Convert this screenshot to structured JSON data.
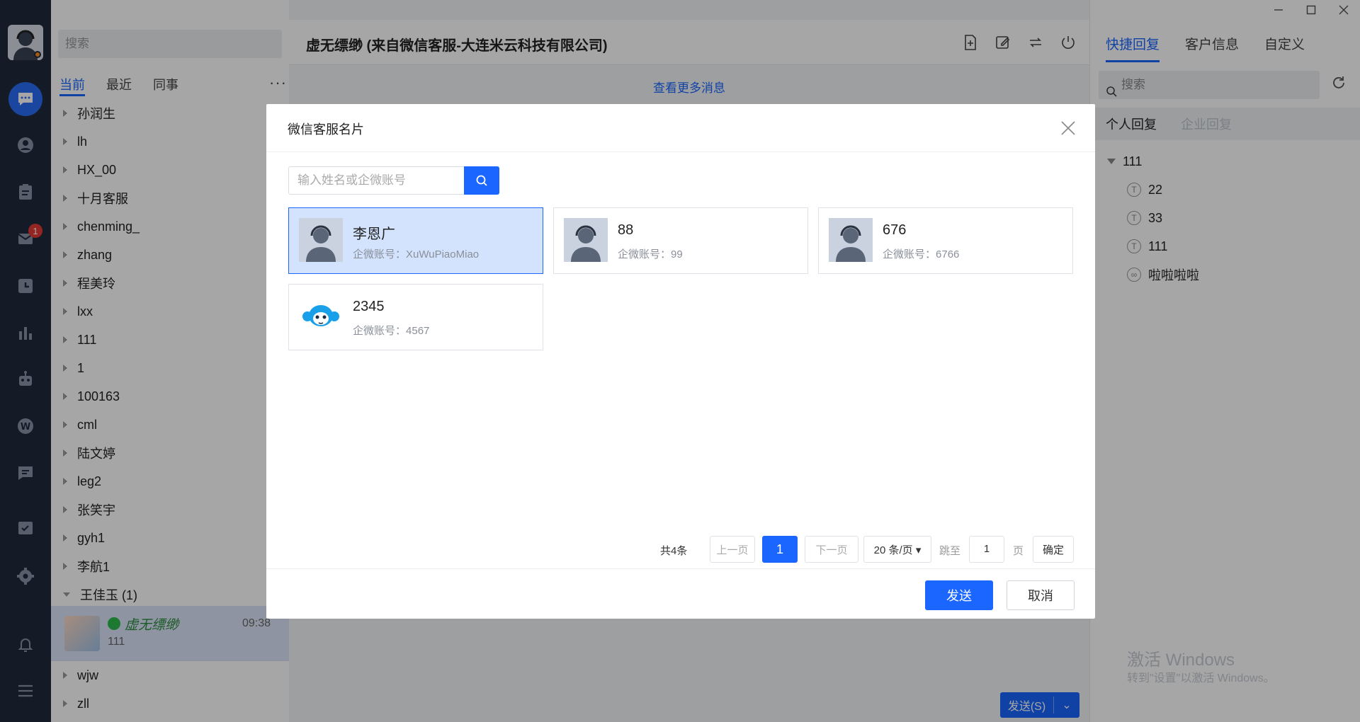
{
  "window": {
    "controls": [
      "minimize",
      "maximize",
      "close"
    ]
  },
  "rail": {
    "unread_badge": "1",
    "icons": [
      "chat-icon",
      "contacts-icon",
      "clipboard-icon",
      "mail-icon",
      "history-icon",
      "stats-icon",
      "robot-icon",
      "weibo-icon",
      "message-icon",
      "tasks-icon",
      "settings-icon",
      "bell-icon",
      "menu-icon"
    ]
  },
  "contacts": {
    "search_placeholder": "搜索",
    "tabs": [
      {
        "label": "当前",
        "active": true
      },
      {
        "label": "最近",
        "active": false
      },
      {
        "label": "同事",
        "active": false
      }
    ],
    "more_label": "···",
    "groups_before": [
      "孙润生",
      "lh",
      "HX_00",
      "十月客服",
      "chenming_",
      "zhang",
      "程美玲",
      "lxx",
      "111",
      "1",
      "100163",
      "cml",
      "陆文婷",
      "leg2",
      "张笑宇",
      "gyh1",
      "李航1",
      "王佳玉 (1)"
    ],
    "session": {
      "name": "虚无缥缈",
      "time": "09:38",
      "message": "111"
    },
    "groups_after": [
      "wjw",
      "zll"
    ]
  },
  "chat": {
    "title": "虚无缥缈 (来自微信客服-大连米云科技有限公司)",
    "more_messages": "查看更多消息",
    "send_label": "发送(S)",
    "send_dropdown": "⌄"
  },
  "right_panel": {
    "tabs": [
      {
        "label": "快捷回复",
        "active": true
      },
      {
        "label": "客户信息",
        "active": false
      },
      {
        "label": "自定义",
        "active": false
      }
    ],
    "search_placeholder": "搜索",
    "subtabs": [
      {
        "label": "个人回复",
        "disabled": false
      },
      {
        "label": "企业回复",
        "disabled": true
      }
    ],
    "tree_root": "111",
    "tree_leaves": [
      {
        "label": "22",
        "icon": "T"
      },
      {
        "label": "33",
        "icon": "T"
      },
      {
        "label": "111",
        "icon": "T"
      },
      {
        "label": "啦啦啦啦",
        "icon": "∞"
      }
    ],
    "watermark_title": "激活 Windows",
    "watermark_sub": "转到\"设置\"以激活 Windows。"
  },
  "modal": {
    "title": "微信客服名片",
    "search_placeholder": "输入姓名或企微账号",
    "cards": [
      {
        "name": "李恩广",
        "account_label": "企微账号：",
        "account": "XuWuPiaoMiao",
        "selected": true,
        "avatar": "agent"
      },
      {
        "name": "88",
        "account_label": "企微账号：",
        "account": "99",
        "selected": false,
        "avatar": "agent"
      },
      {
        "name": "676",
        "account_label": "企微账号：",
        "account": "6766",
        "selected": false,
        "avatar": "agent"
      },
      {
        "name": "2345",
        "account_label": "企微账号：",
        "account": "4567",
        "selected": false,
        "avatar": "mascot"
      }
    ],
    "pager": {
      "total": "共4条",
      "prev": "上一页",
      "current": "1",
      "next": "下一页",
      "page_size": "20 条/页 ▾",
      "jump_label": "跳至",
      "jump_value": "1",
      "page_suffix": "页",
      "confirm": "确定"
    },
    "send": "发送",
    "cancel": "取消"
  },
  "colors": {
    "accent": "#1a66ff",
    "rail": "#1f2a3c",
    "selected_card": "#d3e3fd"
  }
}
